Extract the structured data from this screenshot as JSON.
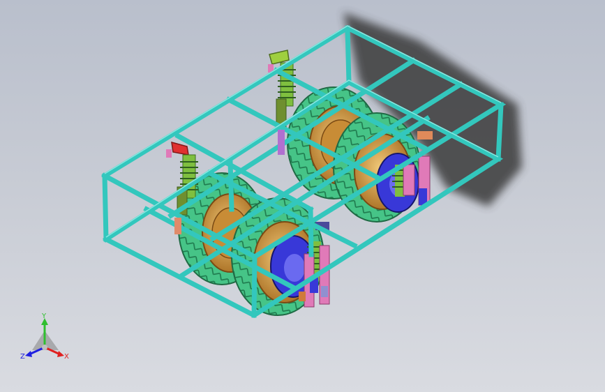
{
  "triad": {
    "x_label": "X",
    "y_label": "Y",
    "z_label": "Z",
    "x_color": "#e02020",
    "y_color": "#2fbf2f",
    "z_color": "#2020e0"
  },
  "colors": {
    "background_top": "#b9bfcc",
    "background_bottom": "#d9dbe1",
    "frame": "#33c7bd",
    "tire": "#4fcf8f",
    "rim": "#d8a24a",
    "hub": "#3838d8",
    "spring": "#5fbf2f",
    "bracket_pink": "#e07ab8",
    "bracket_green": "#6f8f2f",
    "shadow": "#3a3a3a"
  },
  "icons": {
    "triad": "axis-triad-icon"
  }
}
